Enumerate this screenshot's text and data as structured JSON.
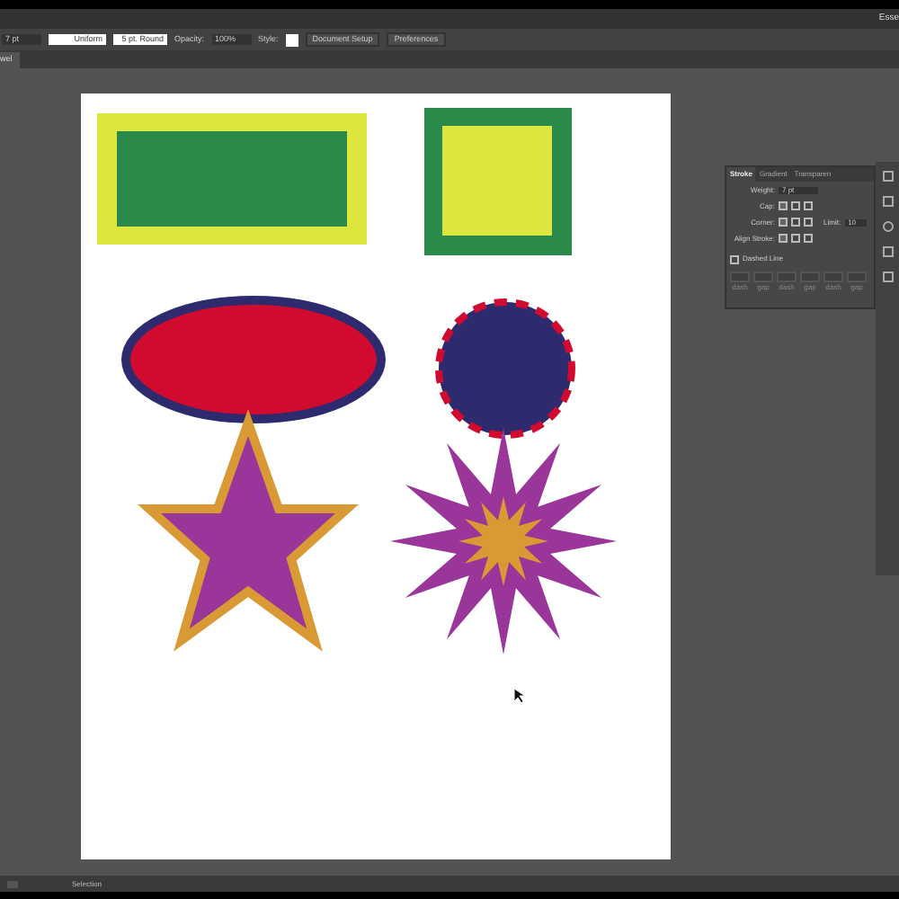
{
  "app_bar": {
    "workspace": "Esse"
  },
  "control_bar": {
    "weight": "7 pt",
    "profile": "Uniform",
    "brush": "5 pt. Round",
    "opacity_label": "Opacity:",
    "opacity": "100%",
    "style_label": "Style:",
    "buttons": [
      "Document Setup",
      "Preferences"
    ]
  },
  "document_tab": {
    "title": "wel"
  },
  "stroke_panel": {
    "tabs": [
      {
        "label": "Stroke",
        "selected": true
      },
      {
        "label": "Gradient",
        "selected": false
      },
      {
        "label": "Transparen",
        "selected": false
      }
    ],
    "weight_label": "Weight:",
    "weight": "7 pt",
    "cap_label": "Cap:",
    "corner_label": "Corner:",
    "limit_label": "Limit:",
    "limit": "10",
    "align_label": "Align Stroke:",
    "dashed_line": {
      "label": "Dashed Line",
      "checked": false
    },
    "dash_labels": [
      "dash",
      "gap",
      "dash",
      "gap",
      "dash",
      "gap"
    ]
  },
  "status_bar": {
    "tool": "Selection"
  }
}
